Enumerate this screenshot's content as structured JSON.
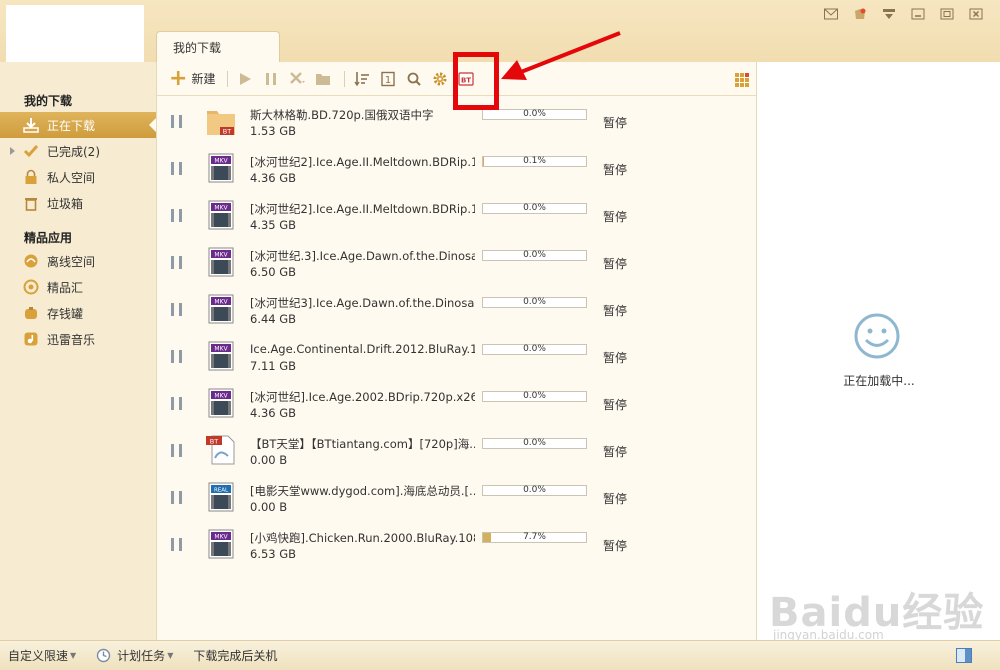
{
  "window": {
    "buttons": [
      "mail-icon",
      "skin-icon",
      "menu-icon",
      "minimize-icon",
      "maximize-icon",
      "close-icon"
    ]
  },
  "tab": {
    "label": "我的下载"
  },
  "toolbar": {
    "new_label": "新建",
    "icons": [
      "play-icon",
      "pause-icon",
      "delete-icon",
      "folder-icon",
      "sort-icon",
      "count-icon",
      "search-icon",
      "settings-icon",
      "bt-icon",
      "apps-icon"
    ]
  },
  "sidebar": {
    "section1": "我的下载",
    "items": [
      {
        "label": "正在下载",
        "icon": "download-icon",
        "active": true
      },
      {
        "label": "已完成(2)",
        "icon": "check-icon",
        "active": false
      },
      {
        "label": "私人空间",
        "icon": "lock-icon",
        "active": false
      },
      {
        "label": "垃圾箱",
        "icon": "trash-icon",
        "active": false
      }
    ],
    "section2": "精品应用",
    "apps": [
      {
        "label": "离线空间",
        "icon": "cloud-icon"
      },
      {
        "label": "精品汇",
        "icon": "gem-icon"
      },
      {
        "label": "存钱罐",
        "icon": "piggy-icon"
      },
      {
        "label": "迅雷音乐",
        "icon": "music-icon"
      }
    ]
  },
  "downloads": [
    {
      "name": "斯大林格勒.BD.720p.国俄双语中字",
      "size": "1.53 GB",
      "progress": "0.0%",
      "fraction": 0.0,
      "status": "暂停",
      "type": "bt-folder"
    },
    {
      "name": "[冰河世纪2].Ice.Age.II.Meltdown.BDRip.1...",
      "size": "4.36 GB",
      "progress": "0.1%",
      "fraction": 0.001,
      "status": "暂停",
      "type": "mkv"
    },
    {
      "name": "[冰河世纪2].Ice.Age.II.Meltdown.BDRip.1...",
      "size": "4.35 GB",
      "progress": "0.0%",
      "fraction": 0.0,
      "status": "暂停",
      "type": "mkv"
    },
    {
      "name": "[冰河世纪.3].Ice.Age.Dawn.of.the.Dinosa...",
      "size": "6.50 GB",
      "progress": "0.0%",
      "fraction": 0.0,
      "status": "暂停",
      "type": "mkv"
    },
    {
      "name": "[冰河世纪3].Ice.Age.Dawn.of.the.Dinosau...",
      "size": "6.44 GB",
      "progress": "0.0%",
      "fraction": 0.0,
      "status": "暂停",
      "type": "mkv"
    },
    {
      "name": "Ice.Age.Continental.Drift.2012.BluRay.10...",
      "size": "7.11 GB",
      "progress": "0.0%",
      "fraction": 0.0,
      "status": "暂停",
      "type": "mkv"
    },
    {
      "name": "[冰河世纪].Ice.Age.2002.BDrip.720p.x26...",
      "size": "4.36 GB",
      "progress": "0.0%",
      "fraction": 0.0,
      "status": "暂停",
      "type": "mkv"
    },
    {
      "name": "【BT天堂】【BTtiantang.com】[720p]海...",
      "size": "0.00 B",
      "progress": "0.0%",
      "fraction": 0.0,
      "status": "暂停",
      "type": "bt-file"
    },
    {
      "name": "[电影天堂www.dygod.com].海底总动员.[...",
      "size": "0.00 B",
      "progress": "0.0%",
      "fraction": 0.0,
      "status": "暂停",
      "type": "real"
    },
    {
      "name": "[小鸡快跑].Chicken.Run.2000.BluRay.108...",
      "size": "6.53 GB",
      "progress": "7.7%",
      "fraction": 0.077,
      "status": "暂停",
      "type": "mkv"
    }
  ],
  "right_panel": {
    "loading": "正在加载中...",
    "watermark": "Baidu经验",
    "watermark_url": "jingyan.baidu.com"
  },
  "statusbar": {
    "speed_label": "自定义限速",
    "schedule_label": "计划任务",
    "shutdown_label": "下载完成后关机"
  },
  "colors": {
    "accent": "#d9a13a",
    "highlight": "#e4080a",
    "sidebar_active": "#d6a84c"
  }
}
